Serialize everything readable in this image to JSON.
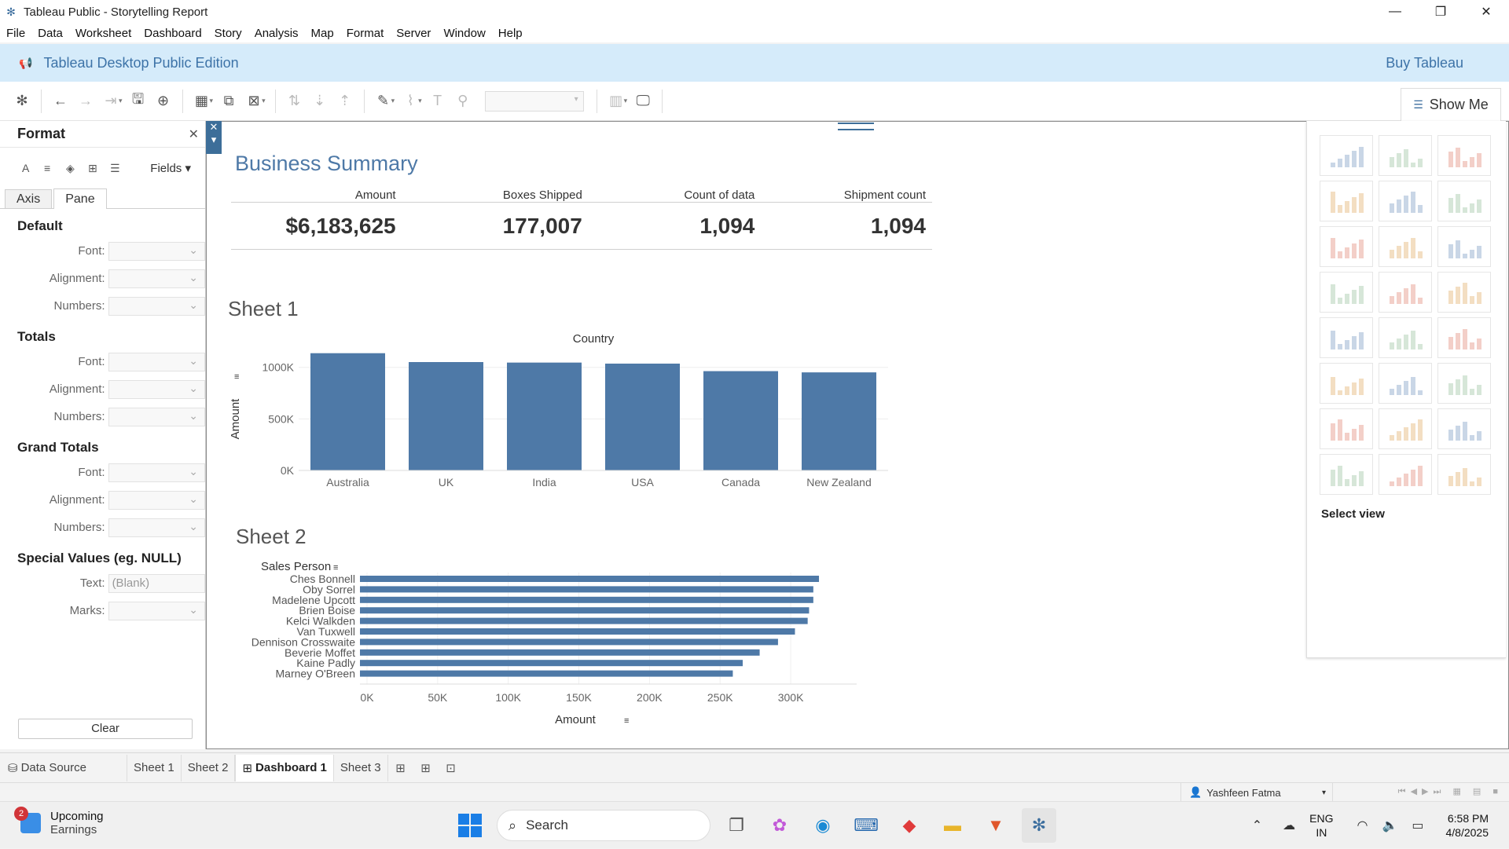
{
  "window": {
    "title": "Tableau Public - Storytelling Report"
  },
  "menu": [
    "File",
    "Data",
    "Worksheet",
    "Dashboard",
    "Story",
    "Analysis",
    "Map",
    "Format",
    "Server",
    "Window",
    "Help"
  ],
  "banner": {
    "edition": "Tableau Desktop Public Edition",
    "buy": "Buy Tableau"
  },
  "toolbar": {
    "show_me": "Show Me"
  },
  "format_panel": {
    "title": "Format",
    "fields_label": "Fields",
    "tabs": [
      "Axis",
      "Pane"
    ],
    "active_tab": "Pane",
    "sections": [
      {
        "title": "Default",
        "rows": [
          {
            "label": "Font:",
            "value": ""
          },
          {
            "label": "Alignment:",
            "value": ""
          },
          {
            "label": "Numbers:",
            "value": ""
          }
        ]
      },
      {
        "title": "Totals",
        "rows": [
          {
            "label": "Font:",
            "value": ""
          },
          {
            "label": "Alignment:",
            "value": ""
          },
          {
            "label": "Numbers:",
            "value": ""
          }
        ]
      },
      {
        "title": "Grand Totals",
        "rows": [
          {
            "label": "Font:",
            "value": ""
          },
          {
            "label": "Alignment:",
            "value": ""
          },
          {
            "label": "Numbers:",
            "value": ""
          }
        ]
      },
      {
        "title": "Special Values (eg. NULL)",
        "rows": [
          {
            "label": "Text:",
            "value": "(Blank)"
          },
          {
            "label": "Marks:",
            "value": ""
          }
        ]
      }
    ],
    "clear_label": "Clear"
  },
  "dashboard": {
    "title": "Business Summary",
    "kpis": [
      {
        "label": "Amount",
        "value": "$6,183,625"
      },
      {
        "label": "Boxes Shipped",
        "value": "177,007"
      },
      {
        "label": "Count of data",
        "value": "1,094"
      },
      {
        "label": "Shipment count",
        "value": "1,094"
      }
    ],
    "sheet1_title": "Sheet 1",
    "sheet2_title": "Sheet 2"
  },
  "chart_data": [
    {
      "type": "bar",
      "title": "Country",
      "ylabel": "Amount",
      "categories": [
        "Australia",
        "UK",
        "India",
        "USA",
        "Canada",
        "New Zealand"
      ],
      "values": [
        1137000,
        1051000,
        1046000,
        1036000,
        963000,
        951000
      ],
      "ylim": [
        0,
        1150000
      ],
      "yticks": [
        {
          "v": 0,
          "label": "0K"
        },
        {
          "v": 500000,
          "label": "500K"
        },
        {
          "v": 1000000,
          "label": "1000K"
        }
      ],
      "color": "#4e79a7"
    },
    {
      "type": "bar",
      "orientation": "horizontal",
      "ylabel": "Sales Person",
      "xlabel": "Amount",
      "categories": [
        "Ches Bonnell",
        "Oby Sorrel",
        "Madelene Upcott",
        "Brien Boise",
        "Kelci Walkden",
        "Van Tuxwell",
        "Dennison Crosswaite",
        "Beverie Moffet",
        "Kaine Padly",
        "Marney O'Breen"
      ],
      "values": [
        320000,
        316000,
        316000,
        313000,
        312000,
        303000,
        291000,
        278000,
        266000,
        259000
      ],
      "xlim": [
        -5000,
        330000
      ],
      "xticks": [
        {
          "v": 0,
          "label": "0K"
        },
        {
          "v": 50000,
          "label": "50K"
        },
        {
          "v": 100000,
          "label": "100K"
        },
        {
          "v": 150000,
          "label": "150K"
        },
        {
          "v": 200000,
          "label": "200K"
        },
        {
          "v": 250000,
          "label": "250K"
        },
        {
          "v": 300000,
          "label": "300K"
        }
      ],
      "color": "#4e79a7"
    }
  ],
  "show_me": {
    "select_view": "Select view"
  },
  "sheet_tabs": {
    "data_source": "Data Source",
    "tabs": [
      "Sheet 1",
      "Sheet 2",
      "Dashboard 1",
      "Sheet 3"
    ],
    "active": "Dashboard 1"
  },
  "status": {
    "user": "Yashfeen Fatma"
  },
  "taskbar": {
    "news_title": "Upcoming",
    "news_sub": "Earnings",
    "news_badge": "2",
    "search": "Search",
    "lang1": "ENG",
    "lang2": "IN",
    "time": "6:58 PM",
    "date": "4/8/2025"
  }
}
